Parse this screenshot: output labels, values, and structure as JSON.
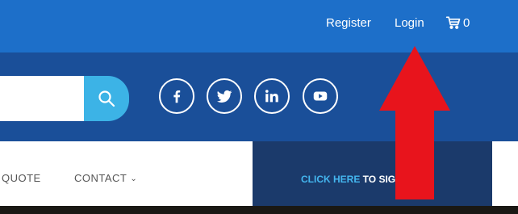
{
  "topbar": {
    "register": "Register",
    "login": "Login",
    "cart_count": "0"
  },
  "nav": {
    "quote": "QUOTE",
    "contact": "CONTACT",
    "chevron": "⌄"
  },
  "cta": {
    "highlight": "CLICK HERE",
    "rest": " TO SIGN UP"
  },
  "icons": [
    "search-icon",
    "facebook-icon",
    "twitter-icon",
    "linkedin-icon",
    "youtube-icon",
    "cart-icon",
    "chevron-down-icon"
  ],
  "colors": {
    "topbar": "#1d6fc9",
    "midbar": "#1a4f99",
    "search_button": "#3cb3e6",
    "cta_bg": "#1b3a6b",
    "cta_highlight": "#44b6ef",
    "annotation_arrow": "#e8141c"
  }
}
